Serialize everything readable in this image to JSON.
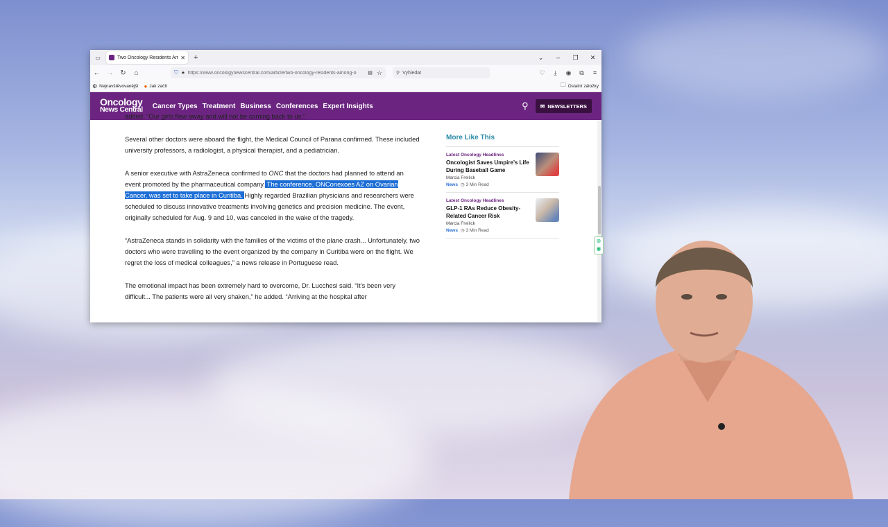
{
  "browser": {
    "tab_title": "Two Oncology Residents Among",
    "url": "https://www.oncologynewscentral.com/article/two-oncology-residents-among-o",
    "search_placeholder": "Vyhledat",
    "bookmarks": [
      "Nejnavštěvovanější",
      "Jak začít"
    ],
    "other_bookmarks": "Ostatní záložky"
  },
  "site": {
    "logo_line1": "Oncology",
    "logo_line2": "News Central",
    "nav": [
      "Cancer Types",
      "Treatment",
      "Business",
      "Conferences",
      "Expert Insights"
    ],
    "newsletters_label": "NEWSLETTERS",
    "brand_color": "#6b2580"
  },
  "article": {
    "p0": "added. “Our girls flew away and will not be coming back to us.”",
    "p1": "Several other doctors were aboard the flight, the Medical Council of Parana confirmed. These included university professors, a radiologist, a physical therapist, and a pediatrician.",
    "p2_before": "A senior executive with AstraZeneca confirmed to ",
    "p2_italic": "ONC",
    "p2_mid": " that the doctors had planned to attend an event promoted by the pharmaceutical company.",
    "p2_highlight": " The conference, ONConexoes AZ on Ovarian Cancer, was set to take place in Curitiba. ",
    "p2_after": "Highly regarded Brazilian physicians and researchers were scheduled to discuss innovative treatments involving genetics and precision medicine. The event, originally scheduled for Aug. 9 and 10, was canceled in the wake of the tragedy.",
    "p3": "“AstraZeneca stands in solidarity with the families of the victims of the plane crash... Unfortunately, two doctors who were travelling to the event organized by the company in Curitiba were on the flight. We regret the loss of medical colleagues,” a news release in Portuguese read.",
    "p4": "The emotional impact has been extremely hard to overcome, Dr. Lucchesi said. “It’s been very difficult... The patients were all very shaken,” he added. “Arriving at the hospital after"
  },
  "sidebar": {
    "title": "More Like This",
    "items": [
      {
        "kicker": "Latest Oncology Headlines",
        "headline": "Oncologist Saves Umpire’s Life During Baseball Game",
        "author": "Marcia Frellick",
        "tag": "News",
        "read": "3 Min Read"
      },
      {
        "kicker": "Latest Oncology Headlines",
        "headline": "GLP-1 RAs Reduce Obesity-Related Cancer Risk",
        "author": "Marcia Frellick",
        "tag": "News",
        "read": "3 Min Read"
      }
    ]
  }
}
